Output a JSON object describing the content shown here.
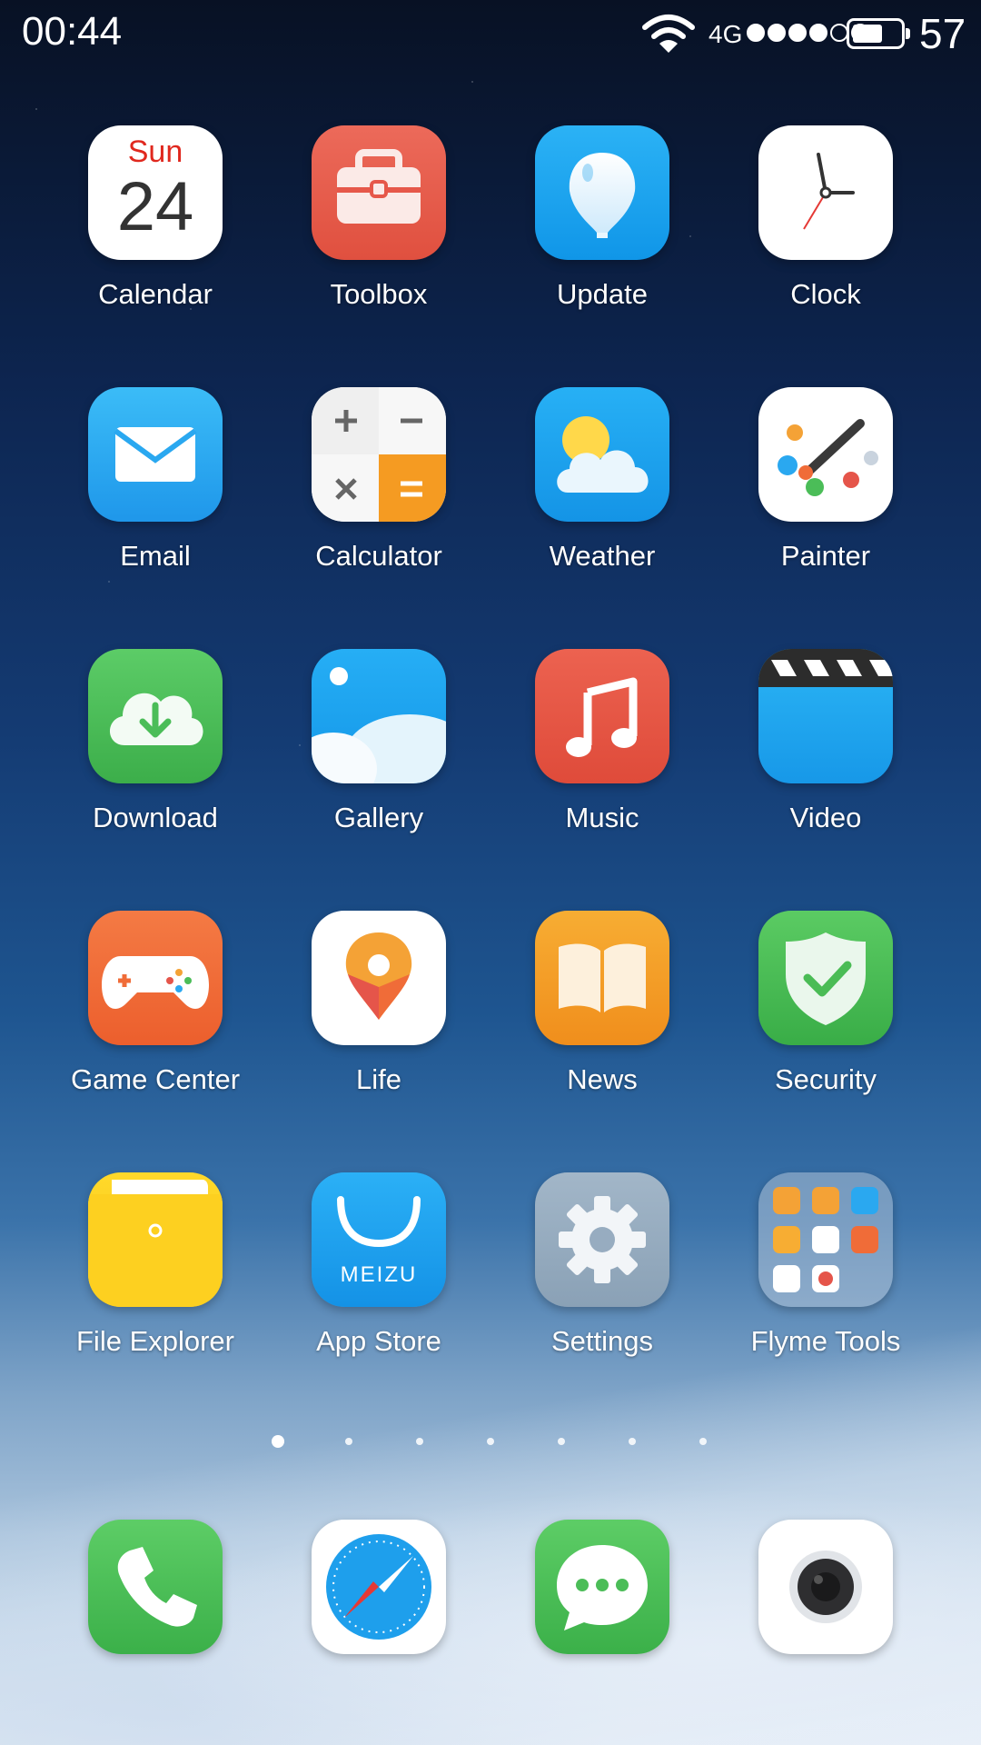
{
  "status_bar": {
    "time": "00:44",
    "network": "4G",
    "signal_filled": 4,
    "signal_total": 6,
    "battery_level": "57"
  },
  "apps": [
    {
      "id": "calendar",
      "label": "Calendar",
      "day": "Sun",
      "date": "24"
    },
    {
      "id": "toolbox",
      "label": "Toolbox"
    },
    {
      "id": "update",
      "label": "Update"
    },
    {
      "id": "clock",
      "label": "Clock"
    },
    {
      "id": "email",
      "label": "Email"
    },
    {
      "id": "calculator",
      "label": "Calculator"
    },
    {
      "id": "weather",
      "label": "Weather"
    },
    {
      "id": "painter",
      "label": "Painter"
    },
    {
      "id": "download",
      "label": "Download"
    },
    {
      "id": "gallery",
      "label": "Gallery"
    },
    {
      "id": "music",
      "label": "Music"
    },
    {
      "id": "video",
      "label": "Video"
    },
    {
      "id": "game-center",
      "label": "Game Center"
    },
    {
      "id": "life",
      "label": "Life"
    },
    {
      "id": "news",
      "label": "News"
    },
    {
      "id": "security",
      "label": "Security"
    },
    {
      "id": "file-explorer",
      "label": "File Explorer"
    },
    {
      "id": "app-store",
      "label": "App Store",
      "icon_text": "MEIZU"
    },
    {
      "id": "settings",
      "label": "Settings"
    },
    {
      "id": "flyme-tools",
      "label": "Flyme Tools"
    }
  ],
  "page_indicator": {
    "pages": 7,
    "current": 1
  },
  "dock": [
    {
      "id": "phone",
      "icon": "phone-icon"
    },
    {
      "id": "browser",
      "icon": "compass-icon"
    },
    {
      "id": "messages",
      "icon": "chat-bubble-icon"
    },
    {
      "id": "camera",
      "icon": "camera-lens-icon"
    }
  ],
  "colors": {
    "calendar_day": "#e0281e",
    "toolbox": "#e6584a",
    "update": "#1fa3ef",
    "email": "#2aa8f0",
    "download": "#4bbd58",
    "music": "#e5554a",
    "game_center": "#f06c38",
    "news": "#f39d26",
    "security": "#4abc55",
    "file_explorer": "#fdd020",
    "settings": "#97acc0"
  }
}
